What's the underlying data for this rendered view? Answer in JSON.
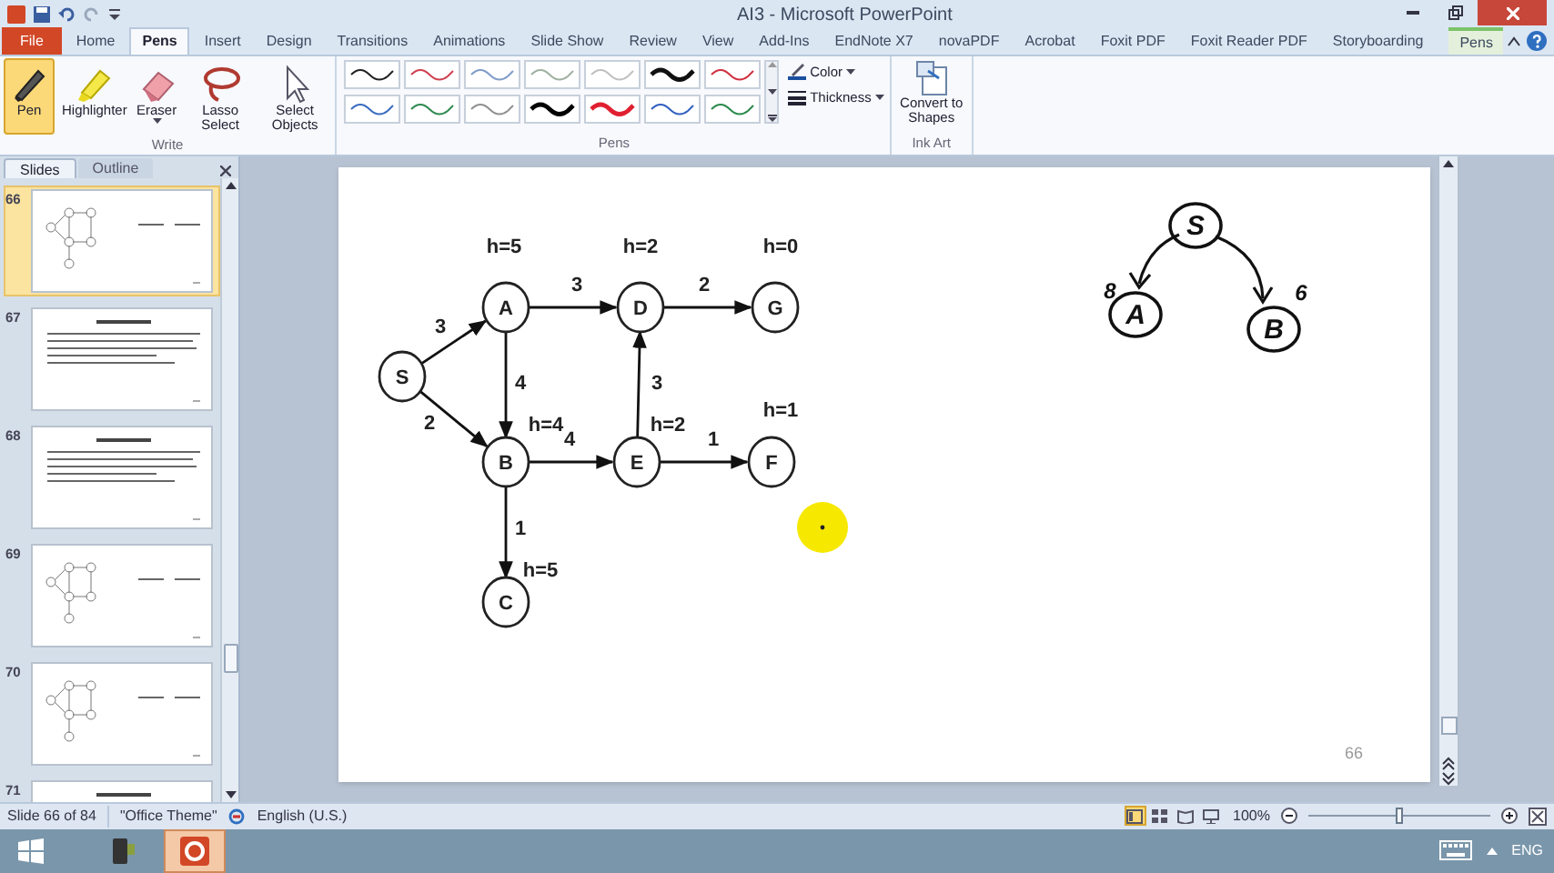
{
  "window": {
    "title": "AI3 - Microsoft PowerPoint"
  },
  "ribbon_tabs": [
    {
      "label": "File",
      "kind": "file",
      "selected": false
    },
    {
      "label": "Home",
      "kind": "tab",
      "selected": false
    },
    {
      "label": "Pens",
      "kind": "tab",
      "selected": true
    },
    {
      "label": "Insert",
      "kind": "tab",
      "selected": false
    },
    {
      "label": "Design",
      "kind": "tab",
      "selected": false
    },
    {
      "label": "Transitions",
      "kind": "tab",
      "selected": false
    },
    {
      "label": "Animations",
      "kind": "tab",
      "selected": false
    },
    {
      "label": "Slide Show",
      "kind": "tab",
      "selected": false
    },
    {
      "label": "Review",
      "kind": "tab",
      "selected": false
    },
    {
      "label": "View",
      "kind": "tab",
      "selected": false
    },
    {
      "label": "Add-Ins",
      "kind": "tab",
      "selected": false
    },
    {
      "label": "EndNote X7",
      "kind": "tab",
      "selected": false
    },
    {
      "label": "novaPDF",
      "kind": "tab",
      "selected": false
    },
    {
      "label": "Acrobat",
      "kind": "tab",
      "selected": false
    },
    {
      "label": "Foxit PDF",
      "kind": "tab",
      "selected": false
    },
    {
      "label": "Foxit Reader PDF",
      "kind": "tab",
      "selected": false
    },
    {
      "label": "Storyboarding",
      "kind": "tab",
      "selected": false
    },
    {
      "label": "Pens",
      "kind": "contextual",
      "selected": false
    }
  ],
  "ribbon": {
    "write": {
      "label": "Write",
      "buttons": [
        {
          "label": "Pen",
          "kind": "pen",
          "selected": true,
          "dropdown": false
        },
        {
          "label": "Highlighter",
          "kind": "highlighter",
          "selected": false,
          "dropdown": false
        },
        {
          "label": "Eraser",
          "kind": "eraser",
          "selected": false,
          "dropdown": true
        },
        {
          "label": "Lasso Select",
          "kind": "lasso",
          "selected": false,
          "dropdown": false
        },
        {
          "label": "Select Objects",
          "kind": "select",
          "selected": false,
          "dropdown": false
        }
      ]
    },
    "pens": {
      "label": "Pens",
      "styles": [
        {
          "color": "#222222"
        },
        {
          "color": "#d04050"
        },
        {
          "color": "#7f9cc8"
        },
        {
          "color": "#9fb0a0"
        },
        {
          "color": "#c0c0c0"
        },
        {
          "color": "#111111"
        },
        {
          "color": "#d03040"
        },
        {
          "color": "#3a6cc0"
        },
        {
          "color": "#2f8a50"
        },
        {
          "color": "#909090"
        },
        {
          "color": "#000000"
        },
        {
          "color": "#e02030"
        },
        {
          "color": "#3060c0"
        },
        {
          "color": "#2a8a4a"
        }
      ],
      "color_button": "Color",
      "thickness_button": "Thickness"
    },
    "ink_art": {
      "label": "Ink Art",
      "button": "Convert to Shapes"
    }
  },
  "slides_panel": {
    "tabs": [
      {
        "label": "Slides",
        "selected": true
      },
      {
        "label": "Outline",
        "selected": false
      }
    ],
    "thumbnails": [
      {
        "number": "66",
        "kind": "graph",
        "selected": true
      },
      {
        "number": "67",
        "kind": "text",
        "selected": false
      },
      {
        "number": "68",
        "kind": "text",
        "selected": false
      },
      {
        "number": "69",
        "kind": "graph",
        "selected": false
      },
      {
        "number": "70",
        "kind": "graph",
        "selected": false
      },
      {
        "number": "71",
        "kind": "text",
        "selected": false
      }
    ]
  },
  "slide": {
    "graph": {
      "nodes": [
        {
          "label": "S"
        },
        {
          "label": "A",
          "h": "h=5"
        },
        {
          "label": "D",
          "h": "h=2"
        },
        {
          "label": "G",
          "h": "h=0"
        },
        {
          "label": "B",
          "h": "h=4"
        },
        {
          "label": "E",
          "h": "h=2"
        },
        {
          "label": "F",
          "h": "h=1"
        },
        {
          "label": "C",
          "h": "h=5"
        }
      ],
      "edges": [
        {
          "weight": "3"
        },
        {
          "weight": "2"
        },
        {
          "weight": "3"
        },
        {
          "weight": "2"
        },
        {
          "weight": "4"
        },
        {
          "weight": "3"
        },
        {
          "weight": "4"
        },
        {
          "weight": "1"
        },
        {
          "weight": "1"
        }
      ]
    },
    "ink": [
      {
        "text": "S",
        "circled": true
      },
      {
        "text": "A",
        "circled": true
      },
      {
        "text": "B",
        "circled": true
      },
      {
        "text": "8",
        "circled": false
      },
      {
        "text": "6",
        "circled": false
      }
    ],
    "page_number": "66"
  },
  "status_bar": {
    "slide": "Slide 66 of 84",
    "theme": "\"Office Theme\"",
    "language": "English (U.S.)",
    "views": [
      {
        "kind": "normal",
        "selected": true
      },
      {
        "kind": "sorter",
        "selected": false
      },
      {
        "kind": "reading",
        "selected": false
      },
      {
        "kind": "show",
        "selected": false
      }
    ],
    "zoom": "100%",
    "zoom_slider": {
      "level": 0.5
    }
  },
  "taskbar": {
    "language": "ENG"
  }
}
